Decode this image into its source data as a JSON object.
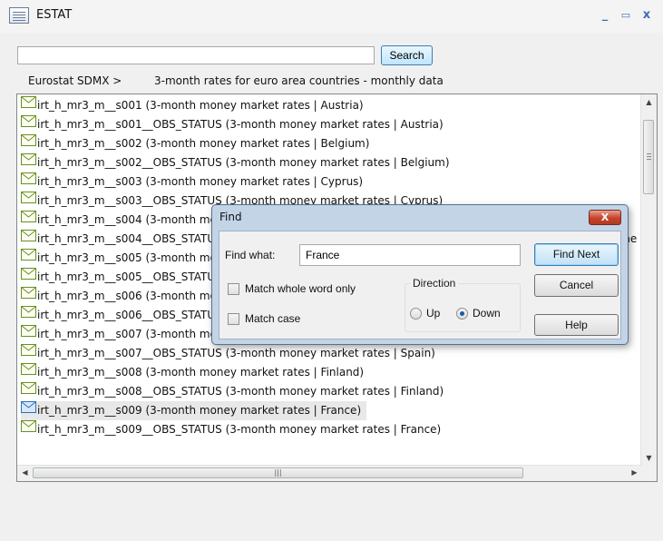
{
  "window": {
    "title": "ESTAT",
    "minimize": "_",
    "maximize": "▭",
    "close": "x"
  },
  "search": {
    "value": "",
    "button_label": "Search"
  },
  "breadcrumb": {
    "root": "Eurostat SDMX >",
    "current": "3-month rates for euro area countries - monthly data"
  },
  "list": {
    "items": [
      {
        "label": "irt_h_mr3_m__s001 (3-month money market rates | Austria)"
      },
      {
        "label": "irt_h_mr3_m__s001__OBS_STATUS (3-month money market rates | Austria)"
      },
      {
        "label": "irt_h_mr3_m__s002 (3-month money market rates | Belgium)"
      },
      {
        "label": "irt_h_mr3_m__s002__OBS_STATUS (3-month money market rates | Belgium)"
      },
      {
        "label": "irt_h_mr3_m__s003 (3-month money market rates | Cyprus)"
      },
      {
        "label": "irt_h_mr3_m__s003__OBS_STATUS (3-month money market rates | Cyprus)"
      },
      {
        "label": "irt_h_mr3_m__s004 (3-month money market rates | Germany (until 1990 former territory of the FRG))"
      },
      {
        "label": "irt_h_mr3_m__s004__OBS_STATUS (3-month money market rates | Germany (until 1990 former territory of the FRG))"
      },
      {
        "label": "irt_h_mr3_m__s005 (3-month money market rates | Estonia)"
      },
      {
        "label": "irt_h_mr3_m__s005__OBS_STATUS (3-month money market rates | Estonia)"
      },
      {
        "label": "irt_h_mr3_m__s006 (3-month money market rates | Greece)"
      },
      {
        "label": "irt_h_mr3_m__s006__OBS_STATUS (3-month money market rates | Greece)"
      },
      {
        "label": "irt_h_mr3_m__s007 (3-month money market rates | Spain)"
      },
      {
        "label": "irt_h_mr3_m__s007__OBS_STATUS (3-month money market rates | Spain)"
      },
      {
        "label": "irt_h_mr3_m__s008 (3-month money market rates | Finland)"
      },
      {
        "label": "irt_h_mr3_m__s008__OBS_STATUS (3-month money market rates | Finland)"
      },
      {
        "label": "irt_h_mr3_m__s009 (3-month money market rates | France)",
        "selected": true
      },
      {
        "label": "irt_h_mr3_m__s009__OBS_STATUS (3-month money market rates | France)"
      }
    ],
    "vertical_scroll_position": 0.1
  },
  "find_dialog": {
    "title": "Find",
    "close": "X",
    "find_what_label": "Find what:",
    "find_what_value": "France",
    "find_next_label": "Find Next",
    "cancel_label": "Cancel",
    "help_label": "Help",
    "match_whole_word_label": "Match whole word only",
    "match_whole_word_checked": false,
    "match_case_label": "Match case",
    "match_case_checked": false,
    "direction_label": "Direction",
    "up_label": "Up",
    "down_label": "Down",
    "direction_selected": "Down"
  },
  "colors": {
    "accent": "#3c7fb1",
    "dialog_frame": "#c3d4e7",
    "close_red": "#c5432b",
    "envelope": "#6b8e23"
  }
}
